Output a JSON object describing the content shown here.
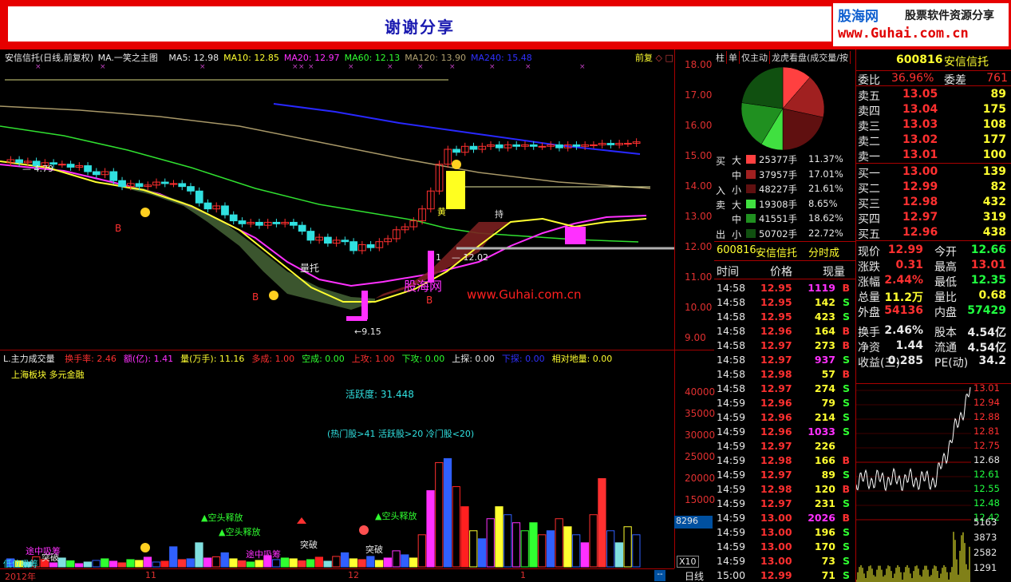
{
  "banner": {
    "title": "谢谢分享",
    "logo_site": "股海网",
    "logo_slogan": "股票软件资源分享",
    "logo_url": "www.Guhai.com.cn"
  },
  "main_chart": {
    "title": "安信信托(日线,前复权)",
    "indicator_name": "MA.一笑之主图",
    "ma_legend": [
      {
        "label": "MA5: 12.98",
        "color": "#e8e8e8"
      },
      {
        "label": "MA10: 12.85",
        "color": "#ffff30"
      },
      {
        "label": "MA20: 12.97",
        "color": "#ff30ff"
      },
      {
        "label": "MA60: 12.13",
        "color": "#30ff30"
      },
      {
        "label": "MA120: 13.90",
        "color": "#b0a070"
      },
      {
        "label": "MA240: 15.48",
        "color": "#3030ff"
      }
    ],
    "right_tag": "前复",
    "price_axis": [
      "18.00",
      "17.00",
      "16.00",
      "15.00",
      "14.00",
      "13.00",
      "12.00",
      "11.00",
      "10.00",
      "9.00"
    ],
    "annotations": {
      "high_left": "4.79",
      "low": "9.15",
      "mid": "12.02",
      "mid_prefix": "1",
      "label_a": "量托",
      "buy_marks": [
        "B",
        "B",
        "B"
      ],
      "watermark_cn": "股海网",
      "watermark_url": "www.Guhai.com.cn",
      "label_huang": "黄",
      "label_chi": "持"
    }
  },
  "sub_chart": {
    "title": "L.主力成交量",
    "legend": [
      {
        "label": "换手率: 2.46",
        "color": "#ff3030"
      },
      {
        "label": "额(亿): 1.41",
        "color": "#ff30ff"
      },
      {
        "label": "量(万手): 11.16",
        "color": "#ffff30"
      },
      {
        "label": "多成: 1.00",
        "color": "#ff3030"
      },
      {
        "label": "空成: 0.00",
        "color": "#30ff30"
      },
      {
        "label": "上攻: 1.00",
        "color": "#ff3030"
      },
      {
        "label": "下攻: 0.00",
        "color": "#30ff30"
      },
      {
        "label": "上探: 0.00",
        "color": "#e8e8e8"
      },
      {
        "label": "下探: 0.00",
        "color": "#3030ff"
      },
      {
        "label": "相对地量: 0.00",
        "color": "#ffff30"
      }
    ],
    "sector": "上海板块 多元金融",
    "activity": "活跃度: 31.448",
    "hint": "(热门股>41 活跃股>20 冷门股<20)",
    "volume_axis": [
      "40000",
      "35000",
      "30000",
      "25000",
      "20000",
      "15000"
    ],
    "current_vol": "8296",
    "scale": "X10",
    "labels": {
      "kongtou1": "▲空头释放",
      "kongtou2": "▲空头释放",
      "kongtou3": "▲空头释放",
      "tupo1": "突破",
      "tupo2": "突破",
      "tupo3": "突破",
      "dikai": "途中吸筹",
      "dikai2": "途中吸筹",
      "bottom_legend": "低位吸筹"
    }
  },
  "time_axis": [
    "2012年",
    "11",
    "12",
    "1"
  ],
  "period_button": "日线",
  "pie_panel": {
    "tabs": [
      "柱",
      "单",
      "仅主动",
      "龙虎看盘(成交量/按"
    ],
    "buy_side": "买",
    "sell_side": "卖",
    "in_label": "入",
    "out_label": "出",
    "rows": [
      {
        "size": "大",
        "vol": "25377手",
        "pct": "11.37%",
        "color": "#ff4040"
      },
      {
        "size": "中",
        "vol": "37957手",
        "pct": "17.01%",
        "color": "#a02020"
      },
      {
        "size": "小",
        "vol": "48227手",
        "pct": "21.61%",
        "color": "#601010"
      },
      {
        "size": "大",
        "vol": "19308手",
        "pct": "8.65%",
        "color": "#40e040"
      },
      {
        "size": "中",
        "vol": "41551手",
        "pct": "18.62%",
        "color": "#209020"
      },
      {
        "size": "小",
        "vol": "50702手",
        "pct": "22.72%",
        "color": "#105010"
      }
    ]
  },
  "stock_header": {
    "code": "600816",
    "name": "安信信托",
    "mode": "分时成"
  },
  "ticks_header": {
    "time": "时间",
    "price": "价格",
    "vol": "现量"
  },
  "ticks": [
    {
      "t": "14:58",
      "p": "12.95",
      "v": "1119",
      "s": "B"
    },
    {
      "t": "14:58",
      "p": "12.95",
      "v": "142",
      "s": "S"
    },
    {
      "t": "14:58",
      "p": "12.95",
      "v": "423",
      "s": "S"
    },
    {
      "t": "14:58",
      "p": "12.96",
      "v": "164",
      "s": "B"
    },
    {
      "t": "14:58",
      "p": "12.97",
      "v": "273",
      "s": "B"
    },
    {
      "t": "14:58",
      "p": "12.97",
      "v": "937",
      "s": "S"
    },
    {
      "t": "14:58",
      "p": "12.98",
      "v": "57",
      "s": "B"
    },
    {
      "t": "14:58",
      "p": "12.97",
      "v": "274",
      "s": "S"
    },
    {
      "t": "14:59",
      "p": "12.96",
      "v": "79",
      "s": "S"
    },
    {
      "t": "14:59",
      "p": "12.96",
      "v": "214",
      "s": "S"
    },
    {
      "t": "14:59",
      "p": "12.96",
      "v": "1033",
      "s": "S"
    },
    {
      "t": "14:59",
      "p": "12.97",
      "v": "226",
      "s": ""
    },
    {
      "t": "14:59",
      "p": "12.98",
      "v": "166",
      "s": "B"
    },
    {
      "t": "14:59",
      "p": "12.97",
      "v": "89",
      "s": "S"
    },
    {
      "t": "14:59",
      "p": "12.98",
      "v": "120",
      "s": "B"
    },
    {
      "t": "14:59",
      "p": "12.97",
      "v": "231",
      "s": "S"
    },
    {
      "t": "14:59",
      "p": "13.00",
      "v": "2026",
      "s": "B"
    },
    {
      "t": "14:59",
      "p": "13.00",
      "v": "196",
      "s": "S"
    },
    {
      "t": "14:59",
      "p": "13.00",
      "v": "170",
      "s": "S"
    },
    {
      "t": "14:59",
      "p": "13.00",
      "v": "73",
      "s": "S"
    },
    {
      "t": "15:00",
      "p": "12.99",
      "v": "71",
      "s": "S"
    }
  ],
  "quote": {
    "code": "600816",
    "name": "安信信托",
    "weibi_label": "委比",
    "weibi": "36.96%",
    "weicha_label": "委差",
    "weicha": "761",
    "asks": [
      {
        "label": "卖五",
        "price": "13.05",
        "vol": "89"
      },
      {
        "label": "卖四",
        "price": "13.04",
        "vol": "175"
      },
      {
        "label": "卖三",
        "price": "13.03",
        "vol": "108"
      },
      {
        "label": "卖二",
        "price": "13.02",
        "vol": "177"
      },
      {
        "label": "卖一",
        "price": "13.01",
        "vol": "100"
      }
    ],
    "bids": [
      {
        "label": "买一",
        "price": "13.00",
        "vol": "139"
      },
      {
        "label": "买二",
        "price": "12.99",
        "vol": "82"
      },
      {
        "label": "买三",
        "price": "12.98",
        "vol": "432"
      },
      {
        "label": "买四",
        "price": "12.97",
        "vol": "319"
      },
      {
        "label": "买五",
        "price": "12.96",
        "vol": "438"
      }
    ],
    "stats": [
      {
        "l1": "现价",
        "v1": "12.99",
        "c1": "red",
        "l2": "今开",
        "v2": "12.66",
        "c2": "green"
      },
      {
        "l1": "涨跌",
        "v1": "0.31",
        "c1": "red",
        "l2": "最高",
        "v2": "13.01",
        "c2": "red"
      },
      {
        "l1": "涨幅",
        "v1": "2.44%",
        "c1": "red",
        "l2": "最低",
        "v2": "12.35",
        "c2": "green"
      },
      {
        "l1": "总量",
        "v1": "11.2万",
        "c1": "yellow",
        "l2": "量比",
        "v2": "0.68",
        "c2": "yellow"
      },
      {
        "l1": "外盘",
        "v1": "54136",
        "c1": "red",
        "l2": "内盘",
        "v2": "57429",
        "c2": "green"
      },
      {
        "l1": "换手",
        "v1": "2.46%",
        "c1": "white",
        "l2": "股本",
        "v2": "4.54亿",
        "c2": "white"
      },
      {
        "l1": "净资",
        "v1": "1.44",
        "c1": "white",
        "l2": "流通",
        "v2": "4.54亿",
        "c2": "white"
      },
      {
        "l1": "收益(三)",
        "v1": "0.285",
        "c1": "white",
        "l2": "PE(动)",
        "v2": "34.2",
        "c2": "white"
      }
    ]
  },
  "intraday_axis": [
    "13.01",
    "12.94",
    "12.88",
    "12.81",
    "12.75",
    "12.68",
    "12.61",
    "12.55",
    "12.48",
    "12.42"
  ],
  "intraday_vol_axis": [
    "5163",
    "3873",
    "2582",
    "1291"
  ],
  "colors": {
    "up": "#ff3030",
    "down": "#30e0e0",
    "frame": "#a00000"
  },
  "chart_data": {
    "type": "candlestick",
    "price_range": [
      8.7,
      18.4
    ],
    "volume_range": [
      0,
      45000
    ],
    "series": [
      {
        "name": "MA240",
        "color": "#3030ff"
      },
      {
        "name": "MA120",
        "color": "#b0a070"
      },
      {
        "name": "MA60",
        "color": "#30ff30"
      },
      {
        "name": "MA20",
        "color": "#ff30ff"
      },
      {
        "name": "MA10",
        "color": "#ffff30"
      }
    ]
  }
}
